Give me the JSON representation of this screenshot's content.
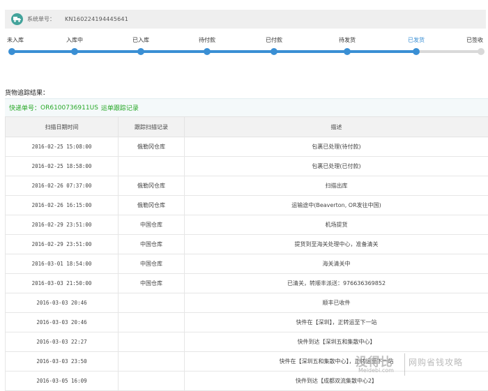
{
  "header": {
    "label": "系统单号：",
    "order_number": "KN160224194445641",
    "logo_icon": "truck-logo-icon"
  },
  "progress": {
    "accent_color": "#3a8fd4",
    "inactive_color": "#d9d9d9",
    "current_index": 7,
    "steps": [
      {
        "label": "未入库"
      },
      {
        "label": "入库中"
      },
      {
        "label": "已入库"
      },
      {
        "label": "待付款"
      },
      {
        "label": "已付款"
      },
      {
        "label": "待发货"
      },
      {
        "label": "已发货"
      },
      {
        "label": "已签收"
      }
    ]
  },
  "section_title": "货物追踪结果：",
  "tracking": {
    "label": "快递单号：",
    "number": "OR6100736911US",
    "link_text": "运单跟踪记录",
    "color": "#27a827"
  },
  "table": {
    "headers": [
      "扫描日期时间",
      "跟踪扫描记录",
      "描述"
    ],
    "rows": [
      {
        "time": "2016-02-25 15:08:00",
        "location": "俄勒冈仓库",
        "desc": "包裹已处理(待付款)"
      },
      {
        "time": "2016-02-25 18:58:00",
        "location": "",
        "desc": "包裹已处理(已付款)"
      },
      {
        "time": "2016-02-26 07:37:00",
        "location": "俄勒冈仓库",
        "desc": "扫描出库"
      },
      {
        "time": "2016-02-26 16:15:00",
        "location": "俄勒冈仓库",
        "desc": "运输途中(Beaverton, OR发往中国)"
      },
      {
        "time": "2016-02-29 23:51:00",
        "location": "中国仓库",
        "desc": "机场提货"
      },
      {
        "time": "2016-02-29 23:51:00",
        "location": "中国仓库",
        "desc": "提货到至海关处理中心，准备清关"
      },
      {
        "time": "2016-03-01 18:54:00",
        "location": "中国仓库",
        "desc": "海关清关中"
      },
      {
        "time": "2016-03-03 21:50:00",
        "location": "中国仓库",
        "desc": "已清关，转顺丰派送：976636369852"
      },
      {
        "time": "2016-03-03 20:46",
        "location": "",
        "desc": "顺丰已收件"
      },
      {
        "time": "2016-03-03 20:46",
        "location": "",
        "desc": "快件在【深圳】，正转运至下一站"
      },
      {
        "time": "2016-03-03 22:27",
        "location": "",
        "desc": "快件到达【深圳五和集散中心】"
      },
      {
        "time": "2016-03-03 23:50",
        "location": "",
        "desc": "快件在【深圳五和集散中心】，正转运至下一站"
      },
      {
        "time": "2016-03-05 16:09",
        "location": "",
        "desc": "快件到达【成都双流集散中心2】"
      }
    ]
  },
  "watermark": {
    "logo": "没得比",
    "site": "Meidebi.com",
    "slogan": "网购省钱攻略"
  }
}
